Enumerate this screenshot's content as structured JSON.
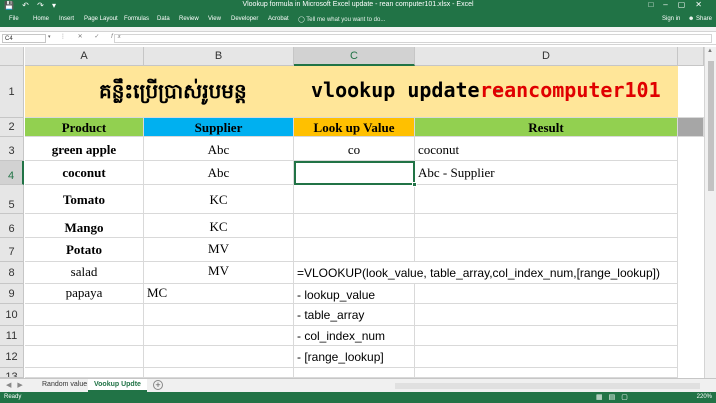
{
  "window": {
    "title": "Vlookup formula in Microsoft Excel update - rean computer101.xlsx - Excel",
    "qat_icons": [
      "save-icon",
      "undo-icon",
      "redo-icon",
      "customize-icon"
    ],
    "window_controls": [
      "ribbon-display-icon",
      "minimize-icon",
      "maximize-icon",
      "close-icon"
    ]
  },
  "ribbon": {
    "tabs": [
      "File",
      "Home",
      "Insert",
      "Page Layout",
      "Formulas",
      "Data",
      "Review",
      "View",
      "Developer",
      "Acrobat"
    ],
    "tell_me": "Tell me what you want to do...",
    "sign_in": "Sign in",
    "share": "Share"
  },
  "formula_bar": {
    "name_box": "C4",
    "fx_label": "fx",
    "content": ""
  },
  "columns": [
    "A",
    "B",
    "C",
    "D"
  ],
  "rows": [
    "1",
    "2",
    "3",
    "4",
    "5",
    "6",
    "7",
    "8",
    "9",
    "10",
    "11",
    "12",
    "13"
  ],
  "sheet_title": {
    "khmer": "គន្លឹះប្រើប្រាស់រូបមន្ត",
    "english": "vlookup update -",
    "brand": "reancomputer101"
  },
  "headers": {
    "product": "Product",
    "supplier": "Supplier",
    "lookup": "Look up Value",
    "result": "Result"
  },
  "table": [
    {
      "product": "green apple",
      "supplier": "Abc"
    },
    {
      "product": "coconut",
      "supplier": "Abc"
    },
    {
      "product": "Tomato",
      "supplier": "KC"
    },
    {
      "product": "Mango",
      "supplier": "KC"
    },
    {
      "product": "Potato",
      "supplier": "MV"
    },
    {
      "product": "salad",
      "supplier": "MV"
    },
    {
      "product": "papaya",
      "supplier": "MC"
    }
  ],
  "lookup_value": "co",
  "results": {
    "row3": "coconut",
    "row4": "Abc - Supplier"
  },
  "formula_notes": {
    "syntax": "=VLOOKUP(look_value, table_array,col_index_num,[range_lookup])",
    "arg1": "- lookup_value",
    "arg2": "- table_array",
    "arg3": "- col_index_num",
    "arg4": "- [range_lookup]"
  },
  "sheets": {
    "tab1": "Random value",
    "tab2": "Vookup Updte"
  },
  "status": {
    "ready": "Ready",
    "zoom": "220%"
  },
  "colors": {
    "excel_green": "#217346",
    "title_band": "#ffe699",
    "product_header": "#92d050",
    "supplier_header": "#00b0f0",
    "lookup_header": "#ffc000",
    "brand_red": "#e00000"
  }
}
